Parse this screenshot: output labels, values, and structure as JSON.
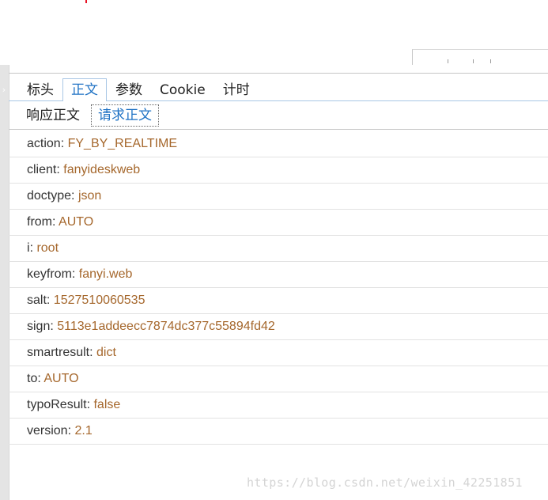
{
  "tabs": [
    "标头",
    "正文",
    "参数",
    "Cookie",
    "计时"
  ],
  "active_tab": "正文",
  "subtabs": [
    "响应正文",
    "请求正文"
  ],
  "active_subtab": "请求正文",
  "rows": [
    {
      "key": "action",
      "value": "FY_BY_REALTIME"
    },
    {
      "key": "client",
      "value": "fanyideskweb"
    },
    {
      "key": "doctype",
      "value": "json"
    },
    {
      "key": "from",
      "value": "AUTO"
    },
    {
      "key": "i",
      "value": "root"
    },
    {
      "key": "keyfrom",
      "value": "fanyi.web"
    },
    {
      "key": "salt",
      "value": "1527510060535"
    },
    {
      "key": "sign",
      "value": "5113e1addeecc7874dc377c55894fd42"
    },
    {
      "key": "smartresult",
      "value": "dict"
    },
    {
      "key": "to",
      "value": "AUTO"
    },
    {
      "key": "typoResult",
      "value": "false"
    },
    {
      "key": "version",
      "value": "2.1"
    }
  ],
  "watermark": "https://blog.csdn.net/weixin_42251851",
  "colors": {
    "accent": "#1f72c4",
    "value": "#a5672c",
    "key": "#333333"
  },
  "icons": {
    "collapse_arrow": "chevron-right-icon"
  }
}
